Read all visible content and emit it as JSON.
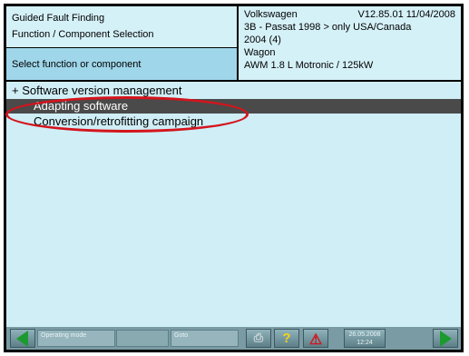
{
  "header": {
    "title": "Guided Fault Finding",
    "subtitle": "Function / Component Selection",
    "prompt": "Select function or component",
    "vehicle": {
      "make": "Volkswagen",
      "version": "V12.85.01 11/04/2008",
      "model": "3B - Passat 1998 > only USA/Canada",
      "year": "2004 (4)",
      "body": "Wagon",
      "engine": "AWM 1.8 L Motronic / 125kW"
    }
  },
  "tree": {
    "items": [
      {
        "label": "+ Software version management",
        "selected": false
      },
      {
        "label": "Adapting software",
        "selected": true
      },
      {
        "label": "Conversion/retrofitting campaign",
        "selected": false
      }
    ]
  },
  "toolbar": {
    "operating_mode": "Operating mode",
    "goto": "Goto",
    "date": "26.05.2008",
    "time": "12:24"
  },
  "colors": {
    "accent": "#9fd6ea",
    "selection": "#4a4a4a",
    "highlight_circle": "#d4141c",
    "nav_arrow": "#1d9a2f"
  },
  "icons": [
    "back-arrow-icon",
    "print-icon",
    "help-icon",
    "warning-icon",
    "forward-arrow-icon"
  ]
}
